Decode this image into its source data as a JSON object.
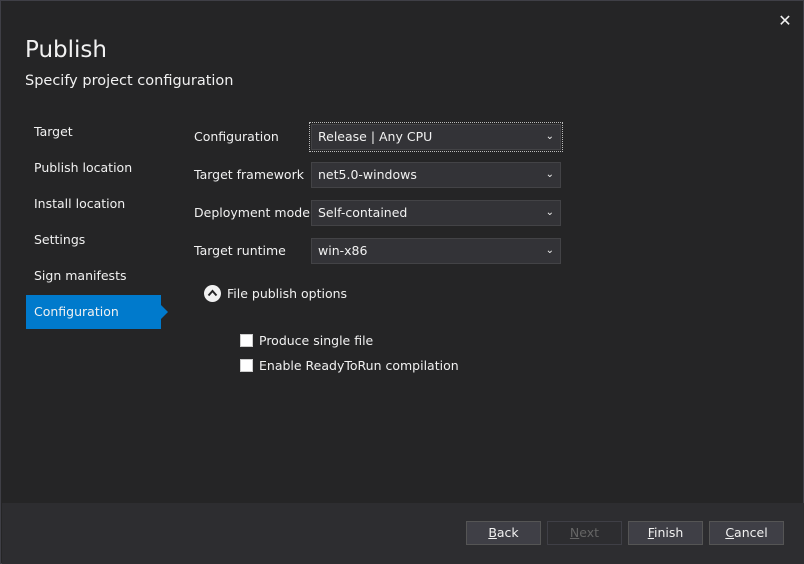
{
  "dialog": {
    "title": "Publish",
    "subtitle": "Specify project configuration",
    "close_icon": "close-icon"
  },
  "nav": {
    "items": [
      {
        "label": "Target",
        "active": false
      },
      {
        "label": "Publish location",
        "active": false
      },
      {
        "label": "Install location",
        "active": false
      },
      {
        "label": "Settings",
        "active": false
      },
      {
        "label": "Sign manifests",
        "active": false
      },
      {
        "label": "Configuration",
        "active": true
      }
    ],
    "active_color": "#007acc"
  },
  "form": {
    "configuration": {
      "label": "Configuration",
      "value": "Release | Any CPU"
    },
    "target_framework": {
      "label": "Target framework",
      "value": "net5.0-windows"
    },
    "deployment_mode": {
      "label": "Deployment mode",
      "value": "Self-contained"
    },
    "target_runtime": {
      "label": "Target runtime",
      "value": "win-x86"
    }
  },
  "file_publish_options": {
    "label": "File publish options",
    "expanded": true,
    "options": [
      {
        "label": "Produce single file",
        "checked": false
      },
      {
        "label": "Enable ReadyToRun compilation",
        "checked": false
      }
    ]
  },
  "footer": {
    "back": {
      "label": "Back",
      "mnemonic": "B",
      "rest": "ack",
      "enabled": true
    },
    "next": {
      "label": "Next",
      "mnemonic": "N",
      "rest": "ext",
      "enabled": false
    },
    "finish": {
      "label": "Finish",
      "mnemonic": "F",
      "rest": "inish",
      "enabled": true
    },
    "cancel": {
      "label": "Cancel",
      "mnemonic": "C",
      "rest": "ancel",
      "enabled": true
    }
  },
  "colors": {
    "background": "#252526",
    "footer": "#2d2d30",
    "accent": "#007acc",
    "text": "#f1f1f1"
  }
}
